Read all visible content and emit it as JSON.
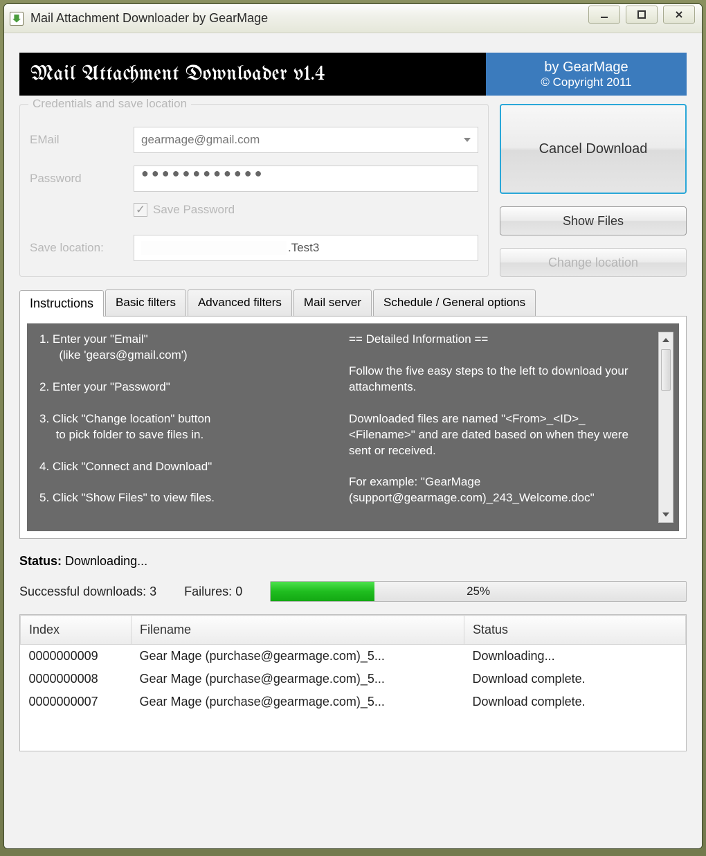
{
  "titlebar": {
    "title": "Mail Attachment Downloader by GearMage"
  },
  "banner": {
    "product": "Mail Attachment Downloader v1.4",
    "by": "by GearMage",
    "copyright": "© Copyright 2011"
  },
  "credentials": {
    "legend": "Credentials and save location",
    "email_label": "EMail",
    "email_value": "gearmage@gmail.com",
    "password_label": "Password",
    "password_masked": "●●●●●●●●●●●●",
    "save_password_label": "Save Password",
    "save_location_label": "Save location:",
    "save_location_suffix": ".Test3"
  },
  "buttons": {
    "cancel": "Cancel Download",
    "show_files": "Show Files",
    "change_location": "Change location"
  },
  "tabs": {
    "items": [
      {
        "label": "Instructions"
      },
      {
        "label": "Basic filters"
      },
      {
        "label": "Advanced filters"
      },
      {
        "label": "Mail server"
      },
      {
        "label": "Schedule / General options"
      }
    ],
    "instructions_left": "1. Enter your \"Email\"\n      (like 'gears@gmail.com')\n\n2. Enter your \"Password\"\n\n3. Click \"Change location\" button\n     to pick folder to save files in.\n\n4. Click \"Connect and Download\"\n\n5. Click \"Show Files\" to view files.",
    "instructions_right": "== Detailed Information ==\n\nFollow the five easy steps to the left to download your attachments.\n\nDownloaded files are named \"<From>_<ID>_\n<Filename>\" and are dated based on when they were sent or received.\n\nFor example: \"GearMage (support@gearmage.com)_243_Welcome.doc\""
  },
  "status": {
    "label": "Status:",
    "value": "Downloading...",
    "success_label": "Successful downloads:",
    "success_count": "3",
    "fail_label": "Failures:",
    "fail_count": "0",
    "progress_percent": 25,
    "progress_text": "25%"
  },
  "table": {
    "columns": [
      "Index",
      "Filename",
      "Status"
    ],
    "rows": [
      {
        "index": "0000000009",
        "filename": "Gear Mage  (purchase@gearmage.com)_5...",
        "status": "Downloading..."
      },
      {
        "index": "0000000008",
        "filename": "Gear Mage  (purchase@gearmage.com)_5...",
        "status": "Download complete."
      },
      {
        "index": "0000000007",
        "filename": "Gear Mage  (purchase@gearmage.com)_5...",
        "status": "Download complete."
      }
    ]
  }
}
